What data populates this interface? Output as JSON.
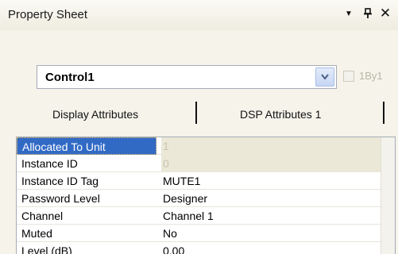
{
  "window": {
    "title": "Property Sheet",
    "buttons": {
      "dropdown_icon": "triangle-down",
      "pin_icon": "pushpin",
      "close_icon": "close-x"
    }
  },
  "control_selector": {
    "value": "Control1",
    "checkbox_label": "1By1",
    "checkbox_checked": false
  },
  "tabs": [
    {
      "label": "Display Attributes",
      "active": true
    },
    {
      "label": "DSP Attributes 1",
      "active": false
    }
  ],
  "properties": [
    {
      "name": "Allocated To Unit",
      "value": "1",
      "selected": true,
      "readonly": true
    },
    {
      "name": "Instance ID",
      "value": "0",
      "selected": false,
      "readonly": true
    },
    {
      "name": "Instance ID Tag",
      "value": "MUTE1",
      "selected": false,
      "readonly": false
    },
    {
      "name": "Password Level",
      "value": "Designer",
      "selected": false,
      "readonly": false
    },
    {
      "name": "Channel",
      "value": "Channel 1",
      "selected": false,
      "readonly": false
    },
    {
      "name": "Muted",
      "value": "No",
      "selected": false,
      "readonly": false
    },
    {
      "name": "Level (dB)",
      "value": "0.00",
      "selected": false,
      "readonly": false
    }
  ],
  "colors": {
    "selection": "#316ac5",
    "readonly_bg": "#ebe8d8",
    "panel_bg": "#f5f3ea"
  }
}
